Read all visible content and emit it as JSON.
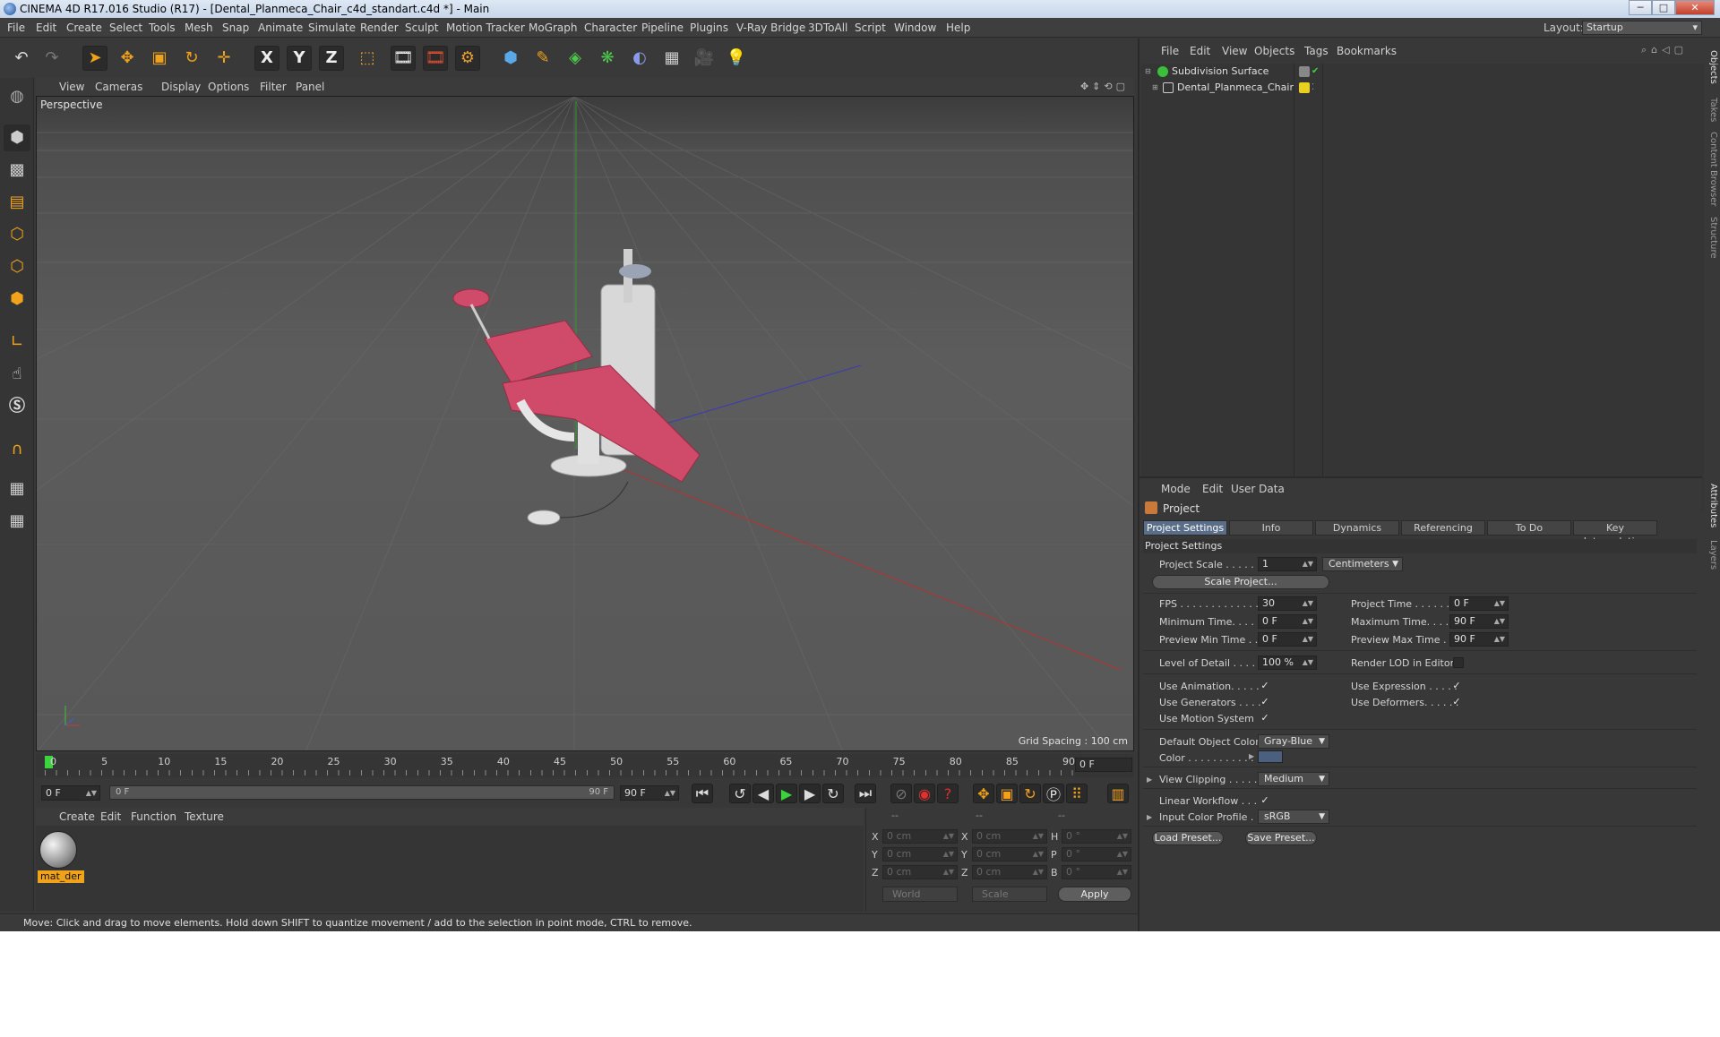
{
  "titlebar": {
    "title": "CINEMA 4D R17.016 Studio (R17) - [Dental_Planmeca_Chair_c4d_standart.c4d *] - Main",
    "minimize": "─",
    "maximize": "□",
    "close": "✕"
  },
  "menubar": {
    "items": [
      "File",
      "Edit",
      "Create",
      "Select",
      "Tools",
      "Mesh",
      "Snap",
      "Animate",
      "Simulate",
      "Render",
      "Sculpt",
      "Motion Tracker",
      "MoGraph",
      "Character",
      "Pipeline",
      "Plugins",
      "V-Ray Bridge",
      "3DToAll",
      "Script",
      "Window",
      "Help"
    ],
    "layout_label": "Layout:",
    "layout_value": "Startup"
  },
  "toolbar": {
    "icons": [
      "undo-icon",
      "redo-icon",
      "select-arrow-icon",
      "move-icon",
      "scale-icon",
      "rotate-icon",
      "live-select-icon",
      "x-axis-icon",
      "y-axis-icon",
      "z-axis-icon",
      "world-coord-icon",
      "render-view-icon",
      "render-picture-viewer-icon",
      "render-settings-icon",
      "cube-icon",
      "pen-spline-icon",
      "subdivision-icon",
      "cloner-icon",
      "deformer-icon",
      "floor-icon",
      "camera-icon",
      "light-icon"
    ],
    "axis_x": "X",
    "axis_y": "Y",
    "axis_z": "Z"
  },
  "viewport": {
    "menu": [
      "View",
      "Cameras",
      "Display",
      "Options",
      "Filter",
      "Panel"
    ],
    "camera_label": "Perspective",
    "grid_spacing": "Grid Spacing : 100 cm"
  },
  "timeline": {
    "ticks": [
      "0",
      "5",
      "10",
      "15",
      "20",
      "25",
      "30",
      "35",
      "40",
      "45",
      "50",
      "55",
      "60",
      "65",
      "70",
      "75",
      "80",
      "85",
      "90"
    ],
    "current_frame": "0 F"
  },
  "transport": {
    "start_field": "0 F",
    "slider_left": "0 F",
    "slider_right": "90 F",
    "end_field": "90 F"
  },
  "material_manager": {
    "menu": [
      "Create",
      "Edit",
      "Function",
      "Texture"
    ],
    "material_name": "mat_der"
  },
  "coordinates": {
    "headers": [
      "--",
      "--",
      "--"
    ],
    "rows": [
      {
        "a": "X",
        "v1": "0 cm",
        "b": "X",
        "v2": "0 cm",
        "c": "H",
        "v3": "0 °"
      },
      {
        "a": "Y",
        "v1": "0 cm",
        "b": "Y",
        "v2": "0 cm",
        "c": "P",
        "v3": "0 °"
      },
      {
        "a": "Z",
        "v1": "0 cm",
        "b": "Z",
        "v2": "0 cm",
        "c": "B",
        "v3": "0 °"
      }
    ],
    "mode1": "World",
    "mode2": "Scale",
    "apply": "Apply"
  },
  "statusbar": {
    "text": "Move: Click and drag to move elements. Hold down SHIFT to quantize movement / add to the selection in point mode, CTRL to remove."
  },
  "object_manager": {
    "menu": [
      "File",
      "Edit",
      "View",
      "Objects",
      "Tags",
      "Bookmarks"
    ],
    "objects": [
      {
        "name": "Subdivision Surface"
      },
      {
        "name": "Dental_Planmeca_Chair"
      }
    ],
    "side_tabs": [
      "Objects",
      "Takes",
      "Content Browser",
      "Structure"
    ]
  },
  "attribute_manager": {
    "menu": [
      "Mode",
      "Edit",
      "User Data"
    ],
    "title": "Project",
    "tabs": [
      "Project Settings",
      "Info",
      "Dynamics",
      "Referencing",
      "To Do",
      "Key Interpolation"
    ],
    "section": "Project Settings",
    "project_scale_label": "Project Scale . . . . . .",
    "project_scale_value": "1",
    "project_scale_unit": "Centimeters",
    "scale_project_btn": "Scale Project...",
    "fps_label": "FPS . . . . . . . . . . . . . .",
    "fps_value": "30",
    "project_time_label": "Project Time . . . . . . .",
    "project_time_value": "0 F",
    "min_time_label": "Minimum Time. . . . . .",
    "min_time_value": "0 F",
    "max_time_label": "Maximum Time. . . . . .",
    "max_time_value": "90 F",
    "prev_min_label": "Preview Min Time . .",
    "prev_min_value": "0 F",
    "prev_max_label": "Preview Max Time . . .",
    "prev_max_value": "90 F",
    "lod_label": "Level of Detail . . . . .",
    "lod_value": "100 %",
    "render_lod_label": "Render LOD in Editor",
    "use_animation_label": "Use Animation. . . . .",
    "use_expression_label": "Use Expression . . . . .",
    "use_generators_label": "Use Generators . . . .",
    "use_deformers_label": "Use Deformers. . . . . .",
    "use_motion_label": "Use Motion System",
    "default_color_label": "Default Object Color",
    "default_color_value": "Gray-Blue",
    "color_label": "Color . . . . . . . . . . .",
    "view_clipping_label": "View Clipping . . . . .",
    "view_clipping_value": "Medium",
    "linear_workflow_label": "Linear Workflow . . .",
    "input_profile_label": "Input Color Profile . .",
    "input_profile_value": "sRGB",
    "load_preset": "Load Preset...",
    "save_preset": "Save Preset...",
    "check": "✓",
    "side_tabs": [
      "Attributes",
      "Layers"
    ]
  },
  "colors": {
    "accent": "#f0a21a",
    "active_tab": "#5a6e8a",
    "chair_red": "#d04a6a",
    "timeline_cursor": "#3cd43c"
  }
}
